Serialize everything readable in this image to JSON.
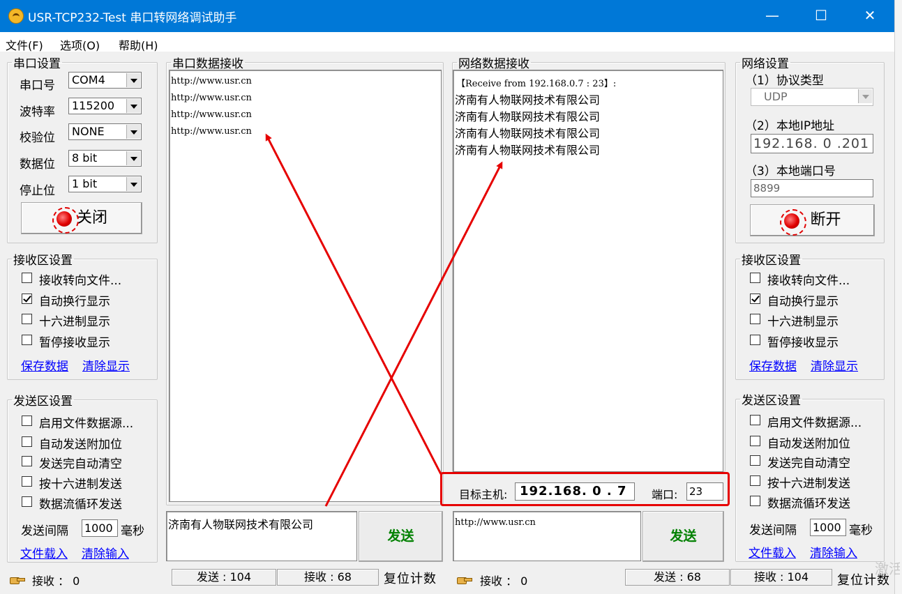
{
  "window": {
    "title": "USR-TCP232-Test 串口转网络调试助手",
    "minimize": "—",
    "maximize": "☐",
    "close": "✕"
  },
  "menu": [
    "文件(F)",
    "选项(O)",
    "帮助(H)"
  ],
  "serial_settings": {
    "title": "串口设置",
    "port_label": "串口号",
    "port_value": "COM4",
    "baud_label": "波特率",
    "baud_value": "115200",
    "parity_label": "校验位",
    "parity_value": "NONE",
    "databits_label": "数据位",
    "databits_value": "8 bit",
    "stopbits_label": "停止位",
    "stopbits_value": "1 bit",
    "button": "关闭"
  },
  "left_recv_settings": {
    "title": "接收区设置",
    "options": [
      {
        "label": "接收转向文件...",
        "checked": false
      },
      {
        "label": "自动换行显示",
        "checked": true
      },
      {
        "label": "十六进制显示",
        "checked": false
      },
      {
        "label": "暂停接收显示",
        "checked": false
      }
    ],
    "save": "保存数据",
    "clear": "清除显示"
  },
  "left_send_settings": {
    "title": "发送区设置",
    "options": [
      {
        "label": "启用文件数据源...",
        "checked": false
      },
      {
        "label": "自动发送附加位",
        "checked": false
      },
      {
        "label": "发送完自动清空",
        "checked": false
      },
      {
        "label": "按十六进制发送",
        "checked": false
      },
      {
        "label": "数据流循环发送",
        "checked": false
      }
    ],
    "interval_label": "发送间隔",
    "interval_value": "1000",
    "interval_unit": "毫秒",
    "load": "文件载入",
    "clear": "清除输入"
  },
  "serial_recv": {
    "title": "串口数据接收",
    "lines": [
      "http://www.usr.cn",
      "http://www.usr.cn",
      "http://www.usr.cn",
      "http://www.usr.cn"
    ]
  },
  "net_recv": {
    "title": "网络数据接收",
    "header": "【Receive from 192.168.0.7 : 23】:",
    "lines": [
      "济南有人物联网技术有限公司",
      "济南有人物联网技术有限公司",
      "济南有人物联网技术有限公司",
      "济南有人物联网技术有限公司"
    ]
  },
  "target": {
    "host_label": "目标主机:",
    "host_value": "192.168. 0 . 7",
    "port_label": "端口:",
    "port_value": "23"
  },
  "serial_send": {
    "text": "济南有人物联网技术有限公司",
    "button": "发送"
  },
  "net_send": {
    "text": "http://www.usr.cn",
    "button": "发送"
  },
  "net_settings": {
    "title": "网络设置",
    "proto_label": "（1）协议类型",
    "proto_value": "UDP",
    "ip_label": "（2）本地IP地址",
    "ip_value": "192.168. 0 .201",
    "port_label": "（3）本地端口号",
    "port_value": "8899",
    "button": "断开"
  },
  "right_recv_settings": {
    "title": "接收区设置",
    "options": [
      {
        "label": "接收转向文件...",
        "checked": false
      },
      {
        "label": "自动换行显示",
        "checked": true
      },
      {
        "label": "十六进制显示",
        "checked": false
      },
      {
        "label": "暂停接收显示",
        "checked": false
      }
    ],
    "save": "保存数据",
    "clear": "清除显示"
  },
  "right_send_settings": {
    "title": "发送区设置",
    "options": [
      {
        "label": "启用文件数据源...",
        "checked": false
      },
      {
        "label": "自动发送附加位",
        "checked": false
      },
      {
        "label": "发送完自动清空",
        "checked": false
      },
      {
        "label": "按十六进制发送",
        "checked": false
      },
      {
        "label": "数据流循环发送",
        "checked": false
      }
    ],
    "interval_label": "发送间隔",
    "interval_value": "1000",
    "interval_unit": "毫秒",
    "load": "文件载入",
    "clear": "清除输入"
  },
  "status_left": {
    "recv_label": "接收 ： 0",
    "sent": "发送 : 104",
    "received": "接收 : 68",
    "reset": "复位计数"
  },
  "status_right": {
    "recv_label": "接收 ： 0",
    "sent": "发送 : 68",
    "received": "接收 : 104",
    "reset": "复位计数"
  },
  "watermark": "激活",
  "annotation": {
    "arrow_color": "#e60000"
  }
}
